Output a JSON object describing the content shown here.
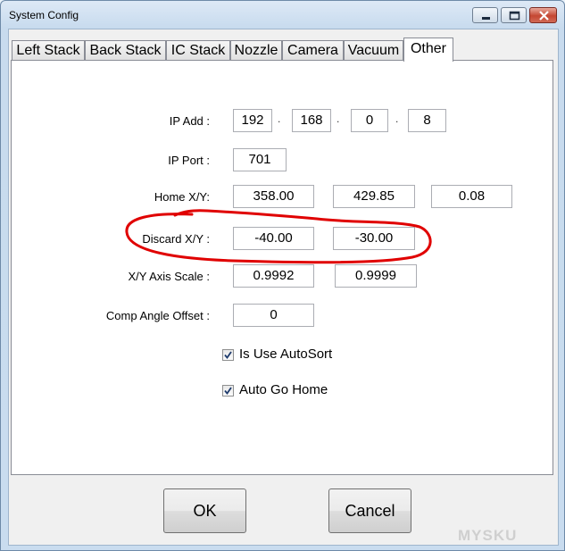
{
  "window": {
    "title": "System Config",
    "controls": [
      "minimize-icon",
      "maximize-icon",
      "close-icon"
    ]
  },
  "tabs": [
    {
      "label": "Left Stack"
    },
    {
      "label": "Back Stack"
    },
    {
      "label": "IC Stack"
    },
    {
      "label": "Nozzle"
    },
    {
      "label": "Camera"
    },
    {
      "label": "Vacuum"
    },
    {
      "label": "Other",
      "active": true
    }
  ],
  "form": {
    "ip_add": {
      "label": "IP Add :",
      "octets": [
        "192",
        "168",
        "0",
        "8"
      ],
      "separator": "."
    },
    "ip_port": {
      "label": "IP Port :",
      "value": "701"
    },
    "home_xy": {
      "label": "Home X/Y:",
      "values": [
        "358.00",
        "429.85",
        "0.08"
      ]
    },
    "discard_xy": {
      "label": "Discard X/Y :",
      "values": [
        "-40.00",
        "-30.00"
      ]
    },
    "axis_scale": {
      "label": "X/Y Axis Scale :",
      "values": [
        "0.9992",
        "0.9999"
      ]
    },
    "comp_angle": {
      "label": "Comp Angle Offset :",
      "value": "0"
    },
    "checkboxes": [
      {
        "label": "Is Use AutoSort",
        "checked": true
      },
      {
        "label": "Auto Go Home",
        "checked": true
      }
    ]
  },
  "buttons": {
    "ok": "OK",
    "cancel": "Cancel"
  },
  "annotation": {
    "color": "#e00000",
    "shape": "hand-drawn ellipse around Discard X/Y row"
  },
  "watermark": "MYSKU"
}
